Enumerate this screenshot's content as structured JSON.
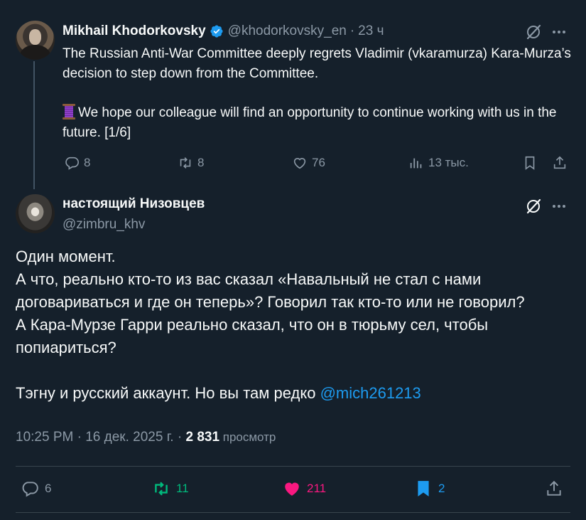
{
  "parent_tweet": {
    "author_name": "Mikhail Khodorkovsky",
    "handle": "@khodorkovsky_en",
    "separator": "·",
    "time": "23 ч",
    "text_line1": "The Russian Anti-War Committee deeply regrets Vladimir (vkaramurza) Kara-Murza’s decision to step down from the Committee.",
    "text_line2": "We hope our colleague will find an opportunity to continue working with us in the future. [1/6]",
    "replies": "8",
    "reposts": "8",
    "likes": "76",
    "views": "13 тыс."
  },
  "main_tweet": {
    "author_name": "настоящий Низовцев",
    "handle": "@zimbru_khv",
    "paragraph1_lines": [
      "Один момент.",
      "А что, реально кто-то из вас сказал «Навальный не стал с нами договариваться и где он теперь»? Говорил так кто-то или не говорил?",
      "А Кара-Мурзе Гарри реально сказал, что он в тюрьму сел, чтобы попиариться?"
    ],
    "paragraph2_text": "Тэгну и русский аккаунт. Но вы там редко ",
    "mention": "@mich261213",
    "timestamp": "10:25 PM · 16 дек. 2025 г. · ",
    "views_count": "2 831",
    "views_label": " просмотр",
    "replies": "6",
    "reposts": "11",
    "likes": "211",
    "bookmarks": "2"
  },
  "colors": {
    "background": "#15202b",
    "muted": "#8b98a5",
    "link": "#1d9bf0",
    "repost_active": "#00ba7c",
    "like_active": "#f91880",
    "bookmark_active": "#1d9bf0"
  },
  "icons": [
    "verified-badge-icon",
    "grok-icon",
    "more-icon",
    "reply-icon",
    "repost-icon",
    "like-icon",
    "views-icon",
    "bookmark-icon",
    "share-icon",
    "spool-emoji-icon"
  ]
}
